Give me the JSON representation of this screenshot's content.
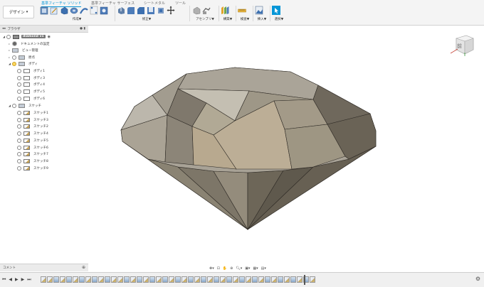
{
  "toolbar": {
    "workspace": "デザイン",
    "tabs": [
      "基準フィーチャ ソリッド",
      "基準フィーチャ サーフェス",
      "シートメタル",
      "ツール"
    ],
    "active_tab": 0,
    "groups": {
      "create": "作成▼",
      "modify": "修正▼",
      "assemble": "アセンブリ▼",
      "construct": "構築▼",
      "inspect": "検査▼",
      "insert": "挿入▼",
      "select": "選択▼"
    }
  },
  "browser": {
    "title": "ブラウザ",
    "nodes": [
      {
        "label": "diamond v1",
        "depth": 0,
        "expanded": true,
        "selected": true
      },
      {
        "label": "ドキュメントの設定",
        "depth": 1
      },
      {
        "label": "ビュー管理",
        "depth": 1
      },
      {
        "label": "原点",
        "depth": 1
      },
      {
        "label": "ボディ",
        "depth": 1,
        "expanded": true
      },
      {
        "label": "ボディ1",
        "depth": 2
      },
      {
        "label": "ボディ3",
        "depth": 2
      },
      {
        "label": "ボディ4",
        "depth": 2
      },
      {
        "label": "ボディ5",
        "depth": 2
      },
      {
        "label": "ボディ6",
        "depth": 2
      },
      {
        "label": "スケッチ",
        "depth": 1,
        "expanded": true
      },
      {
        "label": "スケッチ1",
        "depth": 2
      },
      {
        "label": "スケッチ3",
        "depth": 2
      },
      {
        "label": "スケッチ2",
        "depth": 2
      },
      {
        "label": "スケッチ4",
        "depth": 2
      },
      {
        "label": "スケッチ5",
        "depth": 2
      },
      {
        "label": "スケッチ6",
        "depth": 2
      },
      {
        "label": "スケッチ7",
        "depth": 2
      },
      {
        "label": "スケッチ8",
        "depth": 2
      },
      {
        "label": "スケッチ9",
        "depth": 2
      }
    ]
  },
  "viewcube": {
    "face": "前"
  },
  "comments": {
    "label": "コメント"
  },
  "timeline": {
    "features": [
      "sketch",
      "sketch",
      "body",
      "sketch",
      "body",
      "sketch",
      "body",
      "sketch",
      "body",
      "sketch",
      "body",
      "sketch",
      "sketch",
      "body",
      "sketch",
      "body",
      "sketch",
      "body",
      "sketch",
      "body",
      "sketch",
      "body",
      "sketch",
      "body",
      "sketch",
      "body",
      "sketch",
      "body",
      "sketch",
      "body",
      "sketch",
      "body",
      "sketch",
      "body",
      "sketch",
      "body",
      "sketch",
      "body",
      "sketch",
      "body",
      "sketch",
      "body",
      "sketch"
    ]
  },
  "colors": {
    "accent": "#0696d7",
    "gem_light": "#a8a296",
    "gem_dark": "#6e6659",
    "gem_warm": "#bcae96"
  }
}
